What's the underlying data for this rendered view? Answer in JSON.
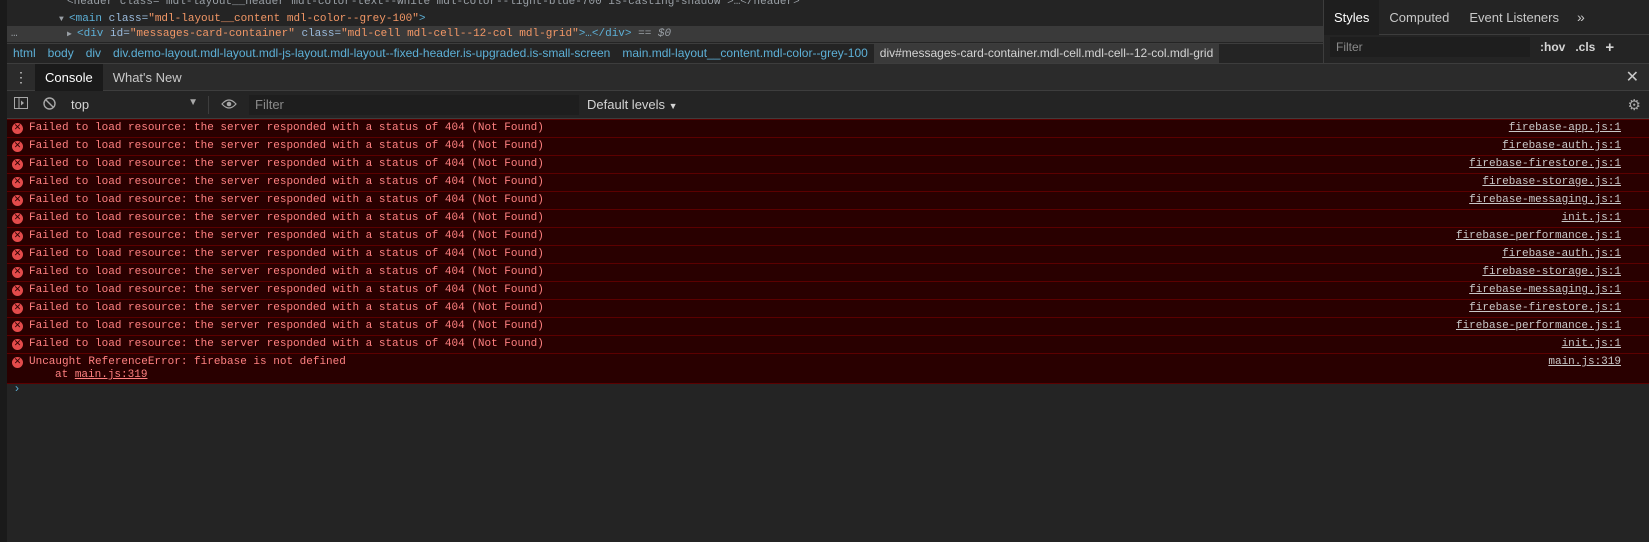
{
  "elements": {
    "line0": "<header class=\"mdl-layout__header mdl-color-text--white mdl-color--light-blue-700 is-casting-shadow\">…</header>",
    "main_tag": "<main",
    "main_attr": " class=",
    "main_val": "\"mdl-layout__content mdl-color--grey-100\"",
    "main_close": ">",
    "div_tag": "<div",
    "div_attr1": " id=",
    "div_val1": "\"messages-card-container\"",
    "div_attr2": " class=",
    "div_val2": "\"mdl-cell mdl-cell--12-col mdl-grid\"",
    "div_close": ">…</div>",
    "div_eq": " == $0",
    "dots": "…"
  },
  "breadcrumb": [
    {
      "label": "html"
    },
    {
      "label": "body"
    },
    {
      "label": "div"
    },
    {
      "label": "div.demo-layout.mdl-layout.mdl-js-layout.mdl-layout--fixed-header.is-upgraded.is-small-screen"
    },
    {
      "label": "main.mdl-layout__content.mdl-color--grey-100"
    },
    {
      "label": "div#messages-card-container.mdl-cell.mdl-cell--12-col.mdl-grid"
    }
  ],
  "styles_panel": {
    "tabs": [
      "Styles",
      "Computed",
      "Event Listeners"
    ],
    "more": "»",
    "filter_placeholder": "Filter",
    "hov": ":hov",
    "cls": ".cls",
    "add": "+"
  },
  "drawer": {
    "tabs": [
      "Console",
      "What's New"
    ],
    "close": "✕"
  },
  "toolbar": {
    "context": "top",
    "filter_placeholder": "Filter",
    "levels": "Default levels"
  },
  "messages": [
    {
      "text": "Failed to load resource: the server responded with a status of 404 (Not Found)",
      "source": "firebase-app.js:1"
    },
    {
      "text": "Failed to load resource: the server responded with a status of 404 (Not Found)",
      "source": "firebase-auth.js:1"
    },
    {
      "text": "Failed to load resource: the server responded with a status of 404 (Not Found)",
      "source": "firebase-firestore.js:1"
    },
    {
      "text": "Failed to load resource: the server responded with a status of 404 (Not Found)",
      "source": "firebase-storage.js:1"
    },
    {
      "text": "Failed to load resource: the server responded with a status of 404 (Not Found)",
      "source": "firebase-messaging.js:1"
    },
    {
      "text": "Failed to load resource: the server responded with a status of 404 (Not Found)",
      "source": "init.js:1"
    },
    {
      "text": "Failed to load resource: the server responded with a status of 404 (Not Found)",
      "source": "firebase-performance.js:1"
    },
    {
      "text": "Failed to load resource: the server responded with a status of 404 (Not Found)",
      "source": "firebase-auth.js:1"
    },
    {
      "text": "Failed to load resource: the server responded with a status of 404 (Not Found)",
      "source": "firebase-storage.js:1"
    },
    {
      "text": "Failed to load resource: the server responded with a status of 404 (Not Found)",
      "source": "firebase-messaging.js:1"
    },
    {
      "text": "Failed to load resource: the server responded with a status of 404 (Not Found)",
      "source": "firebase-firestore.js:1"
    },
    {
      "text": "Failed to load resource: the server responded with a status of 404 (Not Found)",
      "source": "firebase-performance.js:1"
    },
    {
      "text": "Failed to load resource: the server responded with a status of 404 (Not Found)",
      "source": "init.js:1"
    }
  ],
  "uncaught": {
    "text": "Uncaught ReferenceError: firebase is not defined",
    "at": "at",
    "at_link": "main.js:319",
    "source": "main.js:319"
  },
  "prompt": "›"
}
